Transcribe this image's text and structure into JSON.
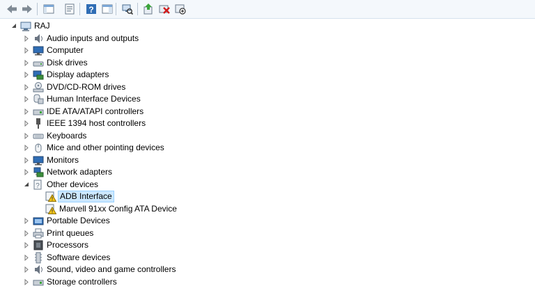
{
  "toolbar": {
    "buttons": [
      {
        "name": "back-button",
        "icon": "arrow-left-icon"
      },
      {
        "name": "forward-button",
        "icon": "arrow-right-icon"
      },
      {
        "name": "show-hide-console-tree-button",
        "icon": "console-tree-icon"
      },
      {
        "name": "properties-button",
        "icon": "properties-icon"
      },
      {
        "name": "help-button",
        "icon": "help-icon"
      },
      {
        "name": "show-action-pane-button",
        "icon": "action-pane-icon"
      },
      {
        "name": "scan-hardware-button",
        "icon": "scan-hardware-icon"
      },
      {
        "name": "update-driver-button",
        "icon": "update-driver-icon"
      },
      {
        "name": "uninstall-device-button",
        "icon": "uninstall-icon"
      },
      {
        "name": "disable-device-button",
        "icon": "disable-device-icon"
      }
    ]
  },
  "tree": {
    "root": {
      "label": "RAJ",
      "icon": "computer-icon",
      "expanded": true
    },
    "categories": [
      {
        "label": "Audio inputs and outputs",
        "icon": "speaker-icon"
      },
      {
        "label": "Computer",
        "icon": "monitor-icon"
      },
      {
        "label": "Disk drives",
        "icon": "disk-drive-icon"
      },
      {
        "label": "Display adapters",
        "icon": "display-adapter-icon"
      },
      {
        "label": "DVD/CD-ROM drives",
        "icon": "dvd-drive-icon"
      },
      {
        "label": "Human Interface Devices",
        "icon": "hid-icon"
      },
      {
        "label": "IDE ATA/ATAPI controllers",
        "icon": "ide-controller-icon"
      },
      {
        "label": "IEEE 1394 host controllers",
        "icon": "ieee1394-icon"
      },
      {
        "label": "Keyboards",
        "icon": "keyboard-icon"
      },
      {
        "label": "Mice and other pointing devices",
        "icon": "mouse-icon"
      },
      {
        "label": "Monitors",
        "icon": "monitor-icon"
      },
      {
        "label": "Network adapters",
        "icon": "network-icon"
      },
      {
        "label": "Other devices",
        "icon": "unknown-device-icon",
        "expanded": true,
        "children": [
          {
            "label": "ADB Interface",
            "icon": "warning-device-icon",
            "selected": true
          },
          {
            "label": "Marvell 91xx Config ATA Device",
            "icon": "warning-device-icon"
          }
        ]
      },
      {
        "label": "Portable Devices",
        "icon": "portable-device-icon"
      },
      {
        "label": "Print queues",
        "icon": "printer-icon"
      },
      {
        "label": "Processors",
        "icon": "processor-icon"
      },
      {
        "label": "Software devices",
        "icon": "software-device-icon"
      },
      {
        "label": "Sound, video and game controllers",
        "icon": "speaker-icon"
      },
      {
        "label": "Storage controllers",
        "icon": "storage-controller-icon"
      }
    ]
  }
}
